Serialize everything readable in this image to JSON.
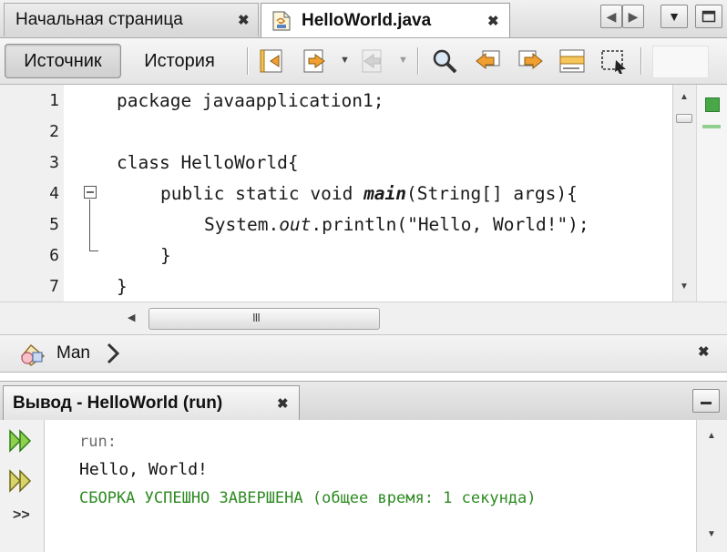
{
  "editor_tabs": {
    "start_page": "Начальная страница",
    "file": "HelloWorld.java",
    "close_glyph": "✖"
  },
  "toolbar": {
    "source": "Источник",
    "history": "История"
  },
  "code": {
    "line_numbers": [
      "1",
      "2",
      "3",
      "4",
      "5",
      "6",
      "7"
    ],
    "line1": "package javaapplication1;",
    "line3": "class HelloWorld{",
    "line4_a": "public static void ",
    "line4_b": "main",
    "line4_c": "(String[] args){",
    "line5_a": "System.",
    "line5_b": "out",
    "line5_c": ".println(\"Hello, World!\");",
    "line6": "}",
    "line7": "}"
  },
  "scroll": {
    "hthumb_grip": "III"
  },
  "navigator": {
    "label": "Man"
  },
  "output": {
    "tab_title": "Вывод - HelloWorld (run)",
    "line_run": "run:",
    "line_hello": "Hello, World!",
    "line_build": "СБОРКА УСПЕШНО ЗАВЕРШЕНА (общее время: 1 секунда)",
    "more": ">>"
  },
  "colors": {
    "build_success": "#2e8b22",
    "run_text": "#6d6d6d",
    "rerun_green": "#3ea314",
    "error_stripe_ok": "#48a848"
  }
}
